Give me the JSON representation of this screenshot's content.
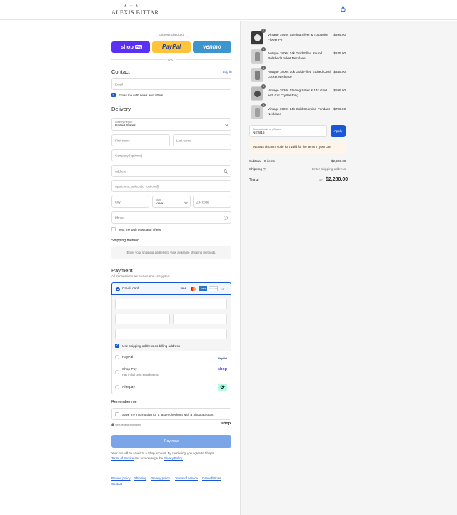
{
  "brand": {
    "logo_mark": "♣ ✚ ♣",
    "logo_text": "ALEXIS BITTAR"
  },
  "express": {
    "title": "Express checkout",
    "shop_pay": "shop",
    "shop_pay_badge": "Pay",
    "paypal": "PayPal",
    "venmo": "venmo",
    "or": "OR"
  },
  "contact": {
    "heading": "Contact",
    "login_link": "Log in",
    "email_placeholder": "Email",
    "email_offers": "Email me with news and offers"
  },
  "delivery": {
    "heading": "Delivery",
    "country_label": "Country/Region",
    "country_value": "United States",
    "first_name": "First name",
    "last_name": "Last name",
    "company": "Company (optional)",
    "address": "Address",
    "apartment": "Apartment, suite, etc. (optional)",
    "city": "City",
    "state_label": "State",
    "state_value": "Iowa",
    "zip": "ZIP code",
    "phone": "Phone",
    "text_offers": "Text me with news and offers"
  },
  "shipping_method": {
    "heading": "Shipping method",
    "notice": "Enter your shipping address to view available shipping methods."
  },
  "payment": {
    "heading": "Payment",
    "subtitle": "All transactions are secure and encrypted.",
    "credit_card": "Credit card",
    "card_brands": [
      "VISA",
      "MC",
      "AMEX",
      "DISCOVER"
    ],
    "more_cards": "+5",
    "billing_same": "Use shipping address as billing address",
    "paypal": "PayPal",
    "paypal_logo": "PayPal",
    "shop_pay": "Shop Pay",
    "shop_pay_sub": "Pay in full or in installments",
    "shop_logo": "shop",
    "afterpay": "Afterpay"
  },
  "remember": {
    "heading": "Remember me",
    "save_info": "Save my information for a faster checkout with a Shop account",
    "secure": "Secure and encrypted",
    "shop_logo": "shop"
  },
  "pay_now": "Pay now",
  "legal": {
    "line1": "Your info will be saved to a Shop account. By continuing, you agree to Shop's",
    "terms": "Terms of Service",
    "and_ack": "and acknowledge the",
    "privacy": "Privacy Policy."
  },
  "footer_links": [
    "Refund policy",
    "Shipping",
    "Privacy policy",
    "Terms of service",
    "Cancellations",
    "Contact"
  ],
  "cart": {
    "items": [
      {
        "qty": "1",
        "name": "Vintage 1940s Sterling Silver & Turquoise Flower Pin",
        "price": "$395.00"
      },
      {
        "qty": "1",
        "name": "Antique 1800s 14k Gold Filled Round Polished Locket Necklace",
        "price": "$245.00"
      },
      {
        "qty": "1",
        "name": "Antique 1800s 10k Gold Filled Etched Oval Locket Necklace",
        "price": "$345.00"
      },
      {
        "qty": "1",
        "name": "Vintage 1920s Sterling Silver & 14k Gold with Cut Crystal Ring",
        "price": "$595.00"
      },
      {
        "qty": "1",
        "name": "Vintage 1980s 14k Gold Scorpion Pendant Necklace",
        "price": "$700.00"
      }
    ],
    "discount_label": "Discount code or gift card",
    "discount_value": "NEW15",
    "apply": "Apply",
    "discount_error": "NEW15 discount code isn't valid for the items in your cart",
    "subtotal_label": "Subtotal · 5 items",
    "subtotal_value": "$2,280.00",
    "shipping_label": "Shipping",
    "shipping_value": "Enter shipping address",
    "total_label": "Total",
    "currency": "USD",
    "total_value": "$2,280.00"
  },
  "colors": {
    "accent": "#1a57d6",
    "shop_pay": "#5a31f4",
    "paypal": "#ffc439",
    "venmo": "#3d95ce",
    "pay_now": "#7aa5e8",
    "error_bg": "#fff5ea"
  }
}
